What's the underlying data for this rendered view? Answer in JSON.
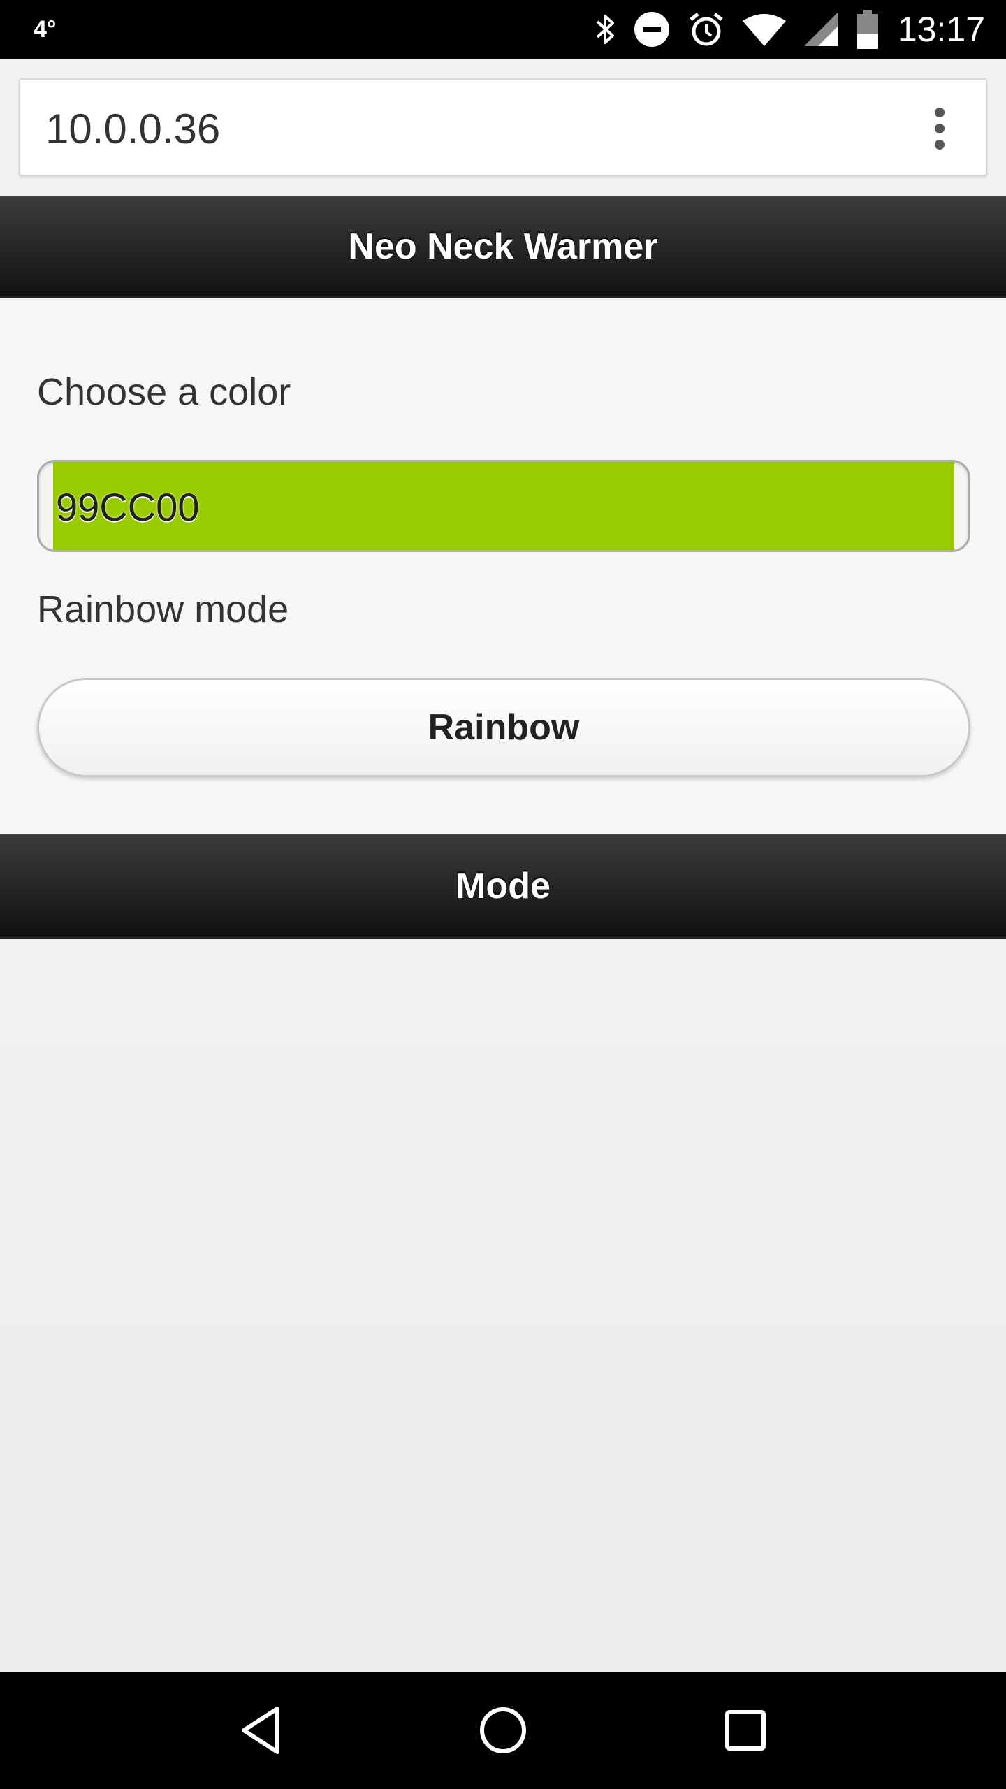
{
  "status_bar": {
    "temperature": "4°",
    "time": "13:17",
    "icons": [
      "bluetooth-icon",
      "do-not-disturb-icon",
      "alarm-icon",
      "wifi-icon",
      "cell-signal-icon",
      "battery-icon"
    ]
  },
  "browser": {
    "url": "10.0.0.36",
    "menu_icon": "more-vert-icon"
  },
  "page": {
    "header_title": "Neo Neck Warmer",
    "color_label": "Choose a color",
    "color_value": "99CC00",
    "color_swatch": "#99cc00",
    "rainbow_label": "Rainbow mode",
    "rainbow_button": "Rainbow",
    "footer_title": "Mode"
  },
  "nav_bar": {
    "icons": [
      "back-icon",
      "home-icon",
      "recents-icon"
    ]
  }
}
